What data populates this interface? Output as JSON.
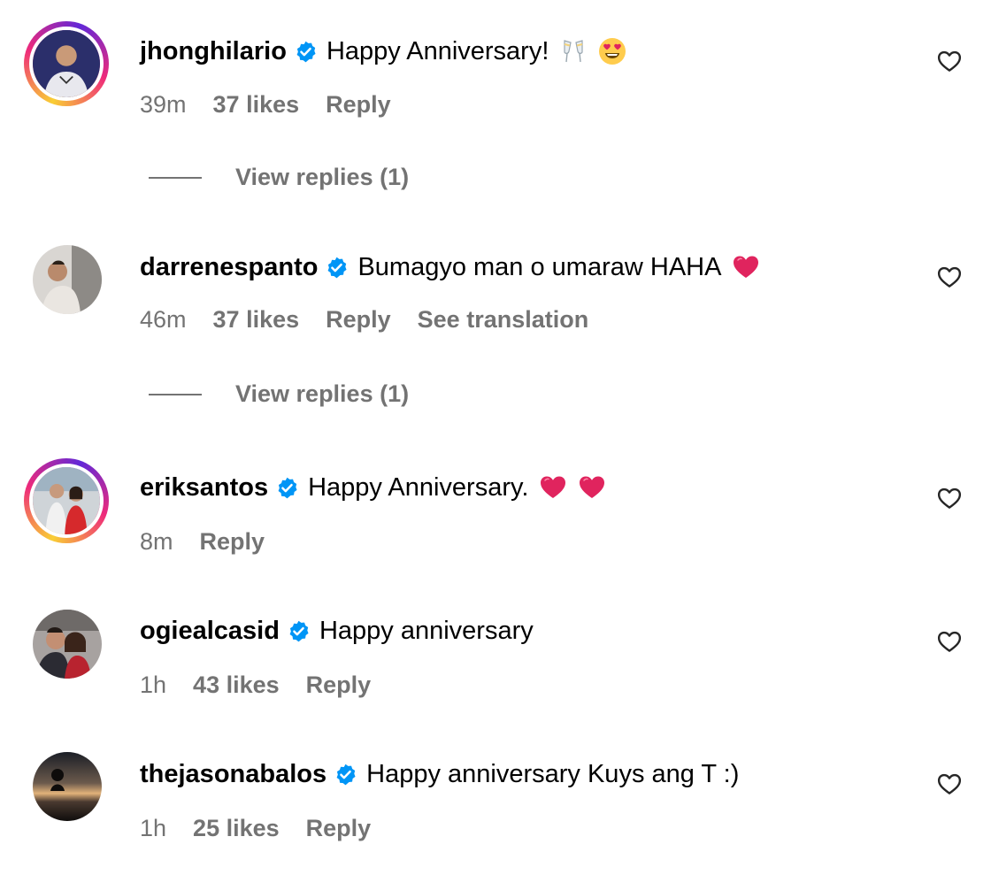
{
  "comments": [
    {
      "username": "jhonghilario",
      "text": "Happy Anniversary!",
      "emojis": [
        "clinking-glasses-emoji",
        "heart-eyes-emoji"
      ],
      "time": "39m",
      "likes": "37 likes",
      "reply": "Reply",
      "view_replies": "View replies (1)",
      "story_ring": true
    },
    {
      "username": "darrenespanto",
      "text": "Bumagyo man o umaraw HAHA",
      "emojis": [
        "red-heart-emoji"
      ],
      "time": "46m",
      "likes": "37 likes",
      "reply": "Reply",
      "see_translation": "See translation",
      "view_replies": "View replies (1)",
      "story_ring": false
    },
    {
      "username": "eriksantos",
      "text": "Happy Anniversary.",
      "emojis": [
        "red-heart-emoji",
        "red-heart-emoji"
      ],
      "time": "8m",
      "reply": "Reply",
      "story_ring": true
    },
    {
      "username": "ogiealcasid",
      "text": "Happy anniversary",
      "time": "1h",
      "likes": "43 likes",
      "reply": "Reply",
      "story_ring": false
    },
    {
      "username": "thejasonabalos",
      "text": "Happy anniversary Kuys ang T :)",
      "time": "1h",
      "likes": "25 likes",
      "reply": "Reply",
      "story_ring": false
    }
  ],
  "colors": {
    "verified": "#0095f6",
    "meta": "#737373",
    "heart": "#e0245e"
  },
  "icons": {
    "verified": "verified-badge-icon",
    "like": "heart-outline-icon"
  }
}
